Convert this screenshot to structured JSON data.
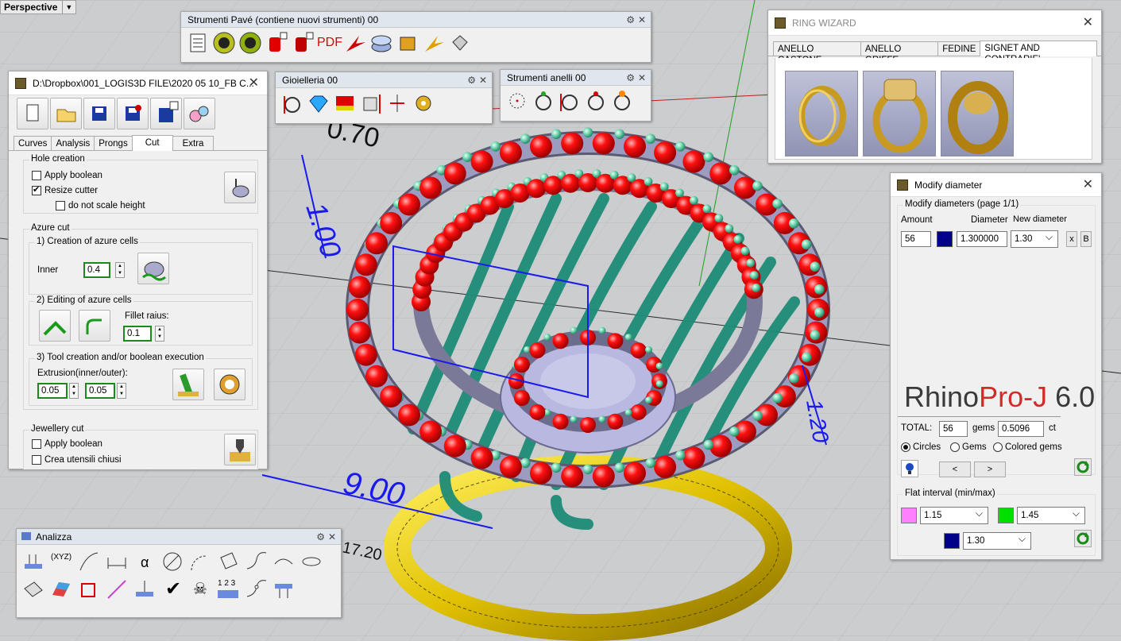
{
  "viewport": {
    "label": "Perspective",
    "dimensions": [
      "0.70",
      "1.00",
      "1.20",
      "9.00",
      "17.20"
    ]
  },
  "toolbars": {
    "pave": {
      "title": "Strumenti Pavé (contiene nuovi strumenti) 00",
      "pdf_label": "PDF"
    },
    "gioielleria": {
      "title": "Gioielleria 00"
    },
    "anelli": {
      "title": "Strumenti anelli 00"
    },
    "analizza": {
      "title": "Analizza",
      "xyz": "(XYZ)",
      "nums": "1 2 3"
    }
  },
  "ring_wizard": {
    "title": "RING WIZARD",
    "tabs": [
      "ANELLO CASTONE",
      "ANELLO GRIFFE",
      "FEDINE",
      "SIGNET AND CONTRARIE'"
    ]
  },
  "cut_window": {
    "title": "D:\\Dropbox\\001_LOGIS3D FILE\\2020 05 10_FB C...",
    "tabs": [
      "Curves",
      "Analysis",
      "Prongs",
      "Cut",
      "Extra"
    ],
    "hole_creation": {
      "title": "Hole creation",
      "apply_boolean": "Apply boolean",
      "resize_cutter": "Resize cutter",
      "no_scale": "do not scale height"
    },
    "azure_cut": {
      "title": "Azure cut",
      "step1": "1) Creation of azure cells",
      "inner_label": "Inner",
      "inner_value": "0.4",
      "step2": "2) Editing of azure cells",
      "fillet_label": "Fillet raius:",
      "fillet_value": "0.1",
      "step3": "3) Tool creation and/or boolean execution",
      "extrusion_label": "Extrusion(inner/outer):",
      "inner_ext": "0.05",
      "outer_ext": "0.05"
    },
    "jewellery_cut": {
      "title": "Jewellery cut",
      "apply_boolean": "Apply boolean",
      "closed_tools": "Crea utensili chiusi"
    }
  },
  "modify_diameter": {
    "title": "Modify diameter",
    "group_title": "Modify diameters (page 1/1)",
    "col_amount": "Amount",
    "col_diameter": "Diameter",
    "col_new": "New diameter",
    "row": {
      "amount": "56",
      "diameter": "1.300000",
      "new": "1.30",
      "x": "x",
      "b": "B",
      "color": "#00008b"
    },
    "brand_a": "Rhino",
    "brand_b": "Pro-J",
    "brand_c": " 6.0",
    "total_label": "TOTAL:",
    "total_gems": "56",
    "gems_label": "gems",
    "total_ct": "0.5096",
    "ct_label": "ct",
    "radios": [
      "Circles",
      "Gems",
      "Colored gems"
    ],
    "prev": "<",
    "next": ">",
    "flat_title": "Flat interval (min/max)",
    "flat_min": "1.15",
    "flat_max": "1.45",
    "flat_mid": "1.30",
    "colors": {
      "min": "#ff80ff",
      "max": "#00e000",
      "mid": "#00008b",
      "brand_red": "#d42a2a"
    }
  }
}
